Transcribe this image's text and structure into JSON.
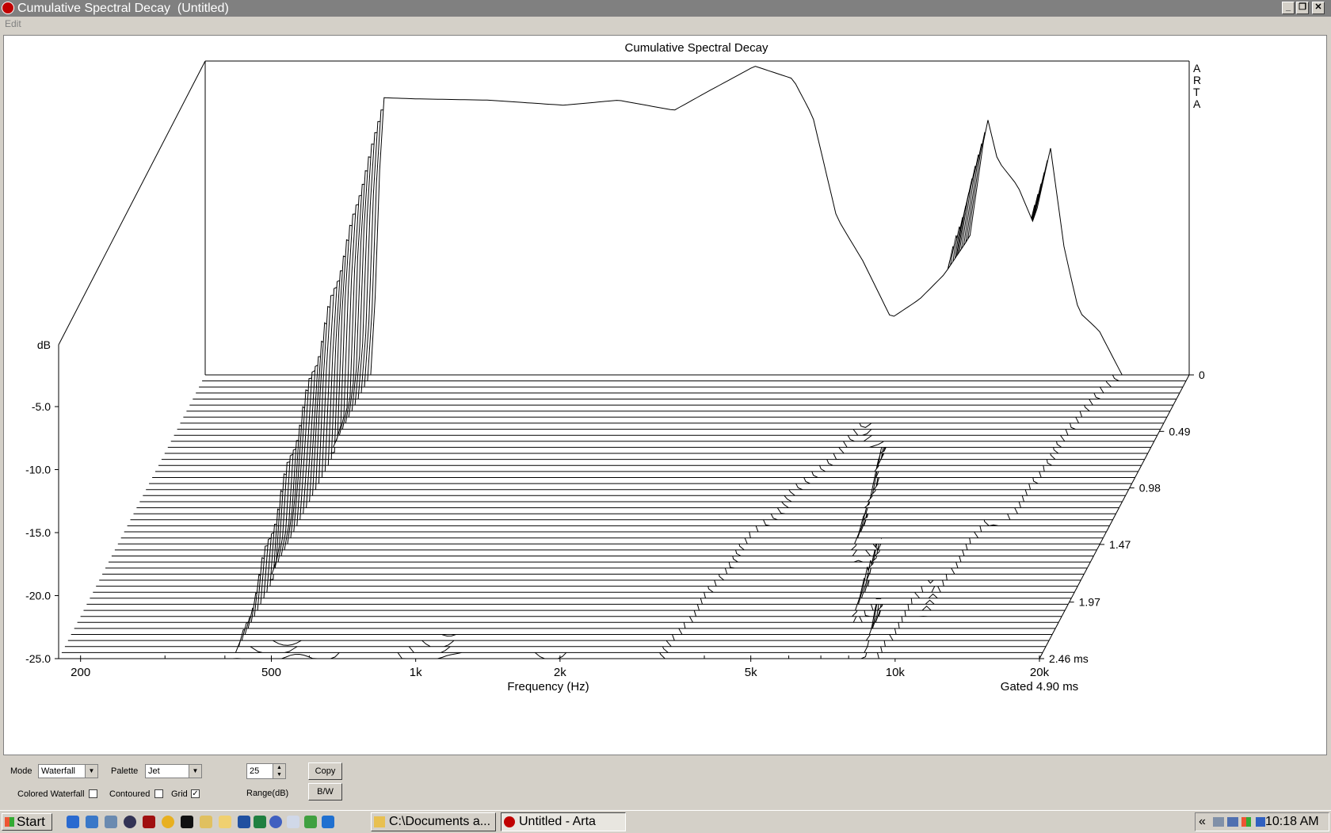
{
  "window": {
    "title": "Cumulative Spectral Decay  (Untitled)",
    "min_icon": "minimize-icon",
    "max_icon": "restore-icon",
    "close_icon": "close-icon"
  },
  "menu": {
    "edit": "Edit"
  },
  "chart_data": {
    "type": "waterfall",
    "title": "Cumulative Spectral Decay",
    "xlabel": "Frequency (Hz)",
    "ylabel": "dB",
    "brand": [
      "A",
      "R",
      "T",
      "A"
    ],
    "gated": "Gated 4.90 ms",
    "x_scale": "log",
    "xlim": [
      180,
      20000
    ],
    "ylim": [
      -25,
      0
    ],
    "x_ticks": [
      {
        "v": 200,
        "label": "200"
      },
      {
        "v": 500,
        "label": "500"
      },
      {
        "v": 1000,
        "label": "1k"
      },
      {
        "v": 2000,
        "label": "2k"
      },
      {
        "v": 5000,
        "label": "5k"
      },
      {
        "v": 10000,
        "label": "10k"
      },
      {
        "v": 20000,
        "label": "20k"
      }
    ],
    "y_ticks": [
      {
        "v": -5,
        "label": "-5.0"
      },
      {
        "v": -10,
        "label": "-10.0"
      },
      {
        "v": -15,
        "label": "-15.0"
      },
      {
        "v": -20,
        "label": "-20.0"
      },
      {
        "v": -25,
        "label": "-25.0"
      }
    ],
    "time_ticks": [
      {
        "t": 0,
        "label": "0"
      },
      {
        "t": 0.49,
        "label": "0.49"
      },
      {
        "t": 0.98,
        "label": "0.98"
      },
      {
        "t": 1.47,
        "label": "1.47"
      },
      {
        "t": 1.97,
        "label": "1.97"
      },
      {
        "t": 2.46,
        "label": "2.46 ms"
      }
    ],
    "time_max_ms": 2.46,
    "slice_count": 48,
    "grid": true,
    "first_slice_db": {
      "freq": [
        400,
        420,
        500,
        700,
        1000,
        1300,
        1700,
        2000,
        2500,
        3000,
        3300,
        3700,
        4200,
        4800,
        5500,
        6200,
        7000,
        7600,
        8000,
        8800,
        9500,
        10300,
        11000,
        11800,
        13000,
        14500,
        16000,
        17500
      ],
      "db": [
        -26,
        -3,
        -3.1,
        -3.2,
        -3.6,
        -3.2,
        -4.0,
        -2.5,
        -0.5,
        -1.5,
        -4.5,
        -12.5,
        -16.0,
        -20.5,
        -19.0,
        -17.0,
        -14.0,
        -4.5,
        -8.0,
        -10.0,
        -13.0,
        -7.0,
        -15.0,
        -20.0,
        -21.5,
        -25.0,
        -25.0,
        -25.0
      ]
    }
  },
  "controls": {
    "mode_label": "Mode",
    "mode_value": "Waterfall",
    "palette_label": "Palette",
    "palette_value": "Jet",
    "range_value": "25",
    "range_label": "Range(dB)",
    "copy_label": "Copy",
    "bw_label": "B/W",
    "colored_label": "Colored Waterfall",
    "colored_checked": false,
    "contoured_label": "Contoured",
    "contoured_checked": false,
    "grid_label": "Grid",
    "grid_checked": true
  },
  "taskbar": {
    "start_label": "Start",
    "tasks": [
      {
        "label": "C:\\Documents a...",
        "icon": "folder-icon",
        "active": false
      },
      {
        "label": "Untitled - Arta",
        "icon": "arta-icon",
        "active": true
      }
    ],
    "tray_chevron": "«",
    "clock": "10:18 AM"
  }
}
